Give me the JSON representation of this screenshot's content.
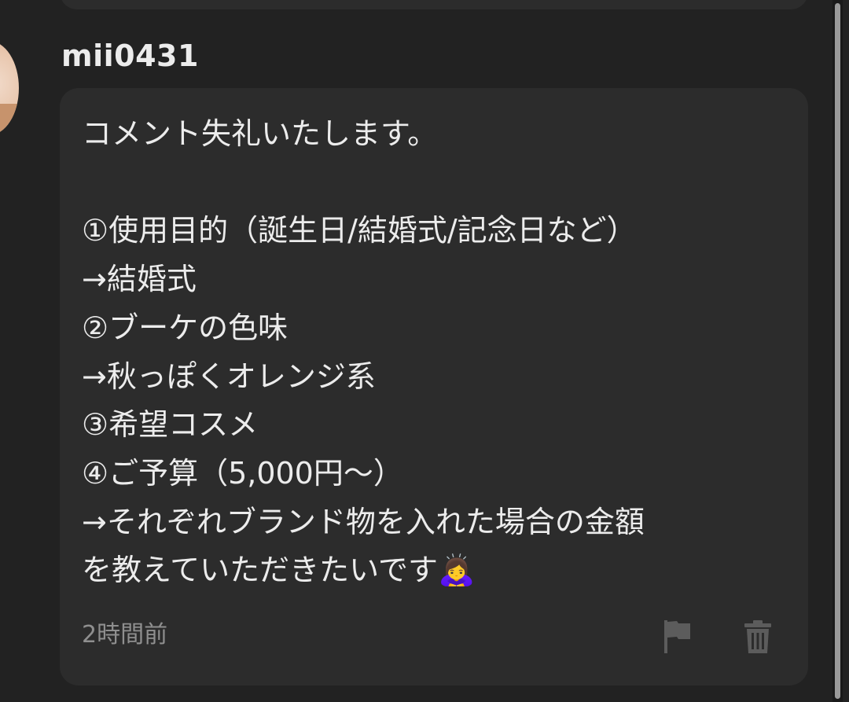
{
  "comment": {
    "username": "mii0431",
    "body": "コメント失礼いたします。\n\n①使用目的（誕生日/結婚式/記念日など）\n→結婚式\n②ブーケの色味\n→秋っぽくオレンジ系\n③希望コスメ\n④ご予算（5,000円〜）\n→それぞれブランド物を入れた場合の金額\nを教えていただきたいです🙇‍♀️",
    "timestamp": "2時間前"
  },
  "icons": {
    "avatar": "user-avatar",
    "report": "flag-icon",
    "delete": "trash-icon"
  },
  "colors": {
    "background": "#222222",
    "card": "#2c2c2c",
    "text": "#ececec",
    "muted": "#8f8f8f",
    "icon": "#5c5c5c"
  }
}
